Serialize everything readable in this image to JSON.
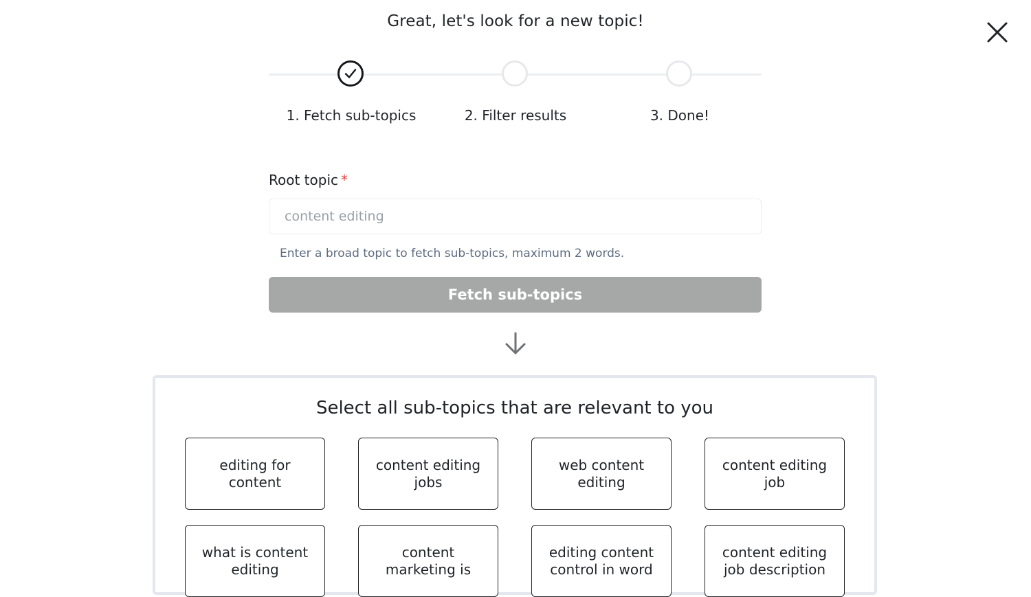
{
  "header": {
    "title": "Great, let's look for a new topic!"
  },
  "steps": [
    {
      "label": "1. Fetch sub-topics",
      "status": "done"
    },
    {
      "label": "2. Filter results",
      "status": "pending"
    },
    {
      "label": "3. Done!",
      "status": "pending"
    }
  ],
  "form": {
    "label": "Root topic",
    "required_mark": "*",
    "input_value": "",
    "input_placeholder": "content editing",
    "helper": "Enter a broad topic to fetch sub-topics, maximum 2 words.",
    "button_label": "Fetch sub-topics"
  },
  "results": {
    "title": "Select all sub-topics that are relevant to you",
    "items": [
      "editing for content",
      "content editing jobs",
      "web content editing",
      "content editing job",
      "what is content editing",
      "content marketing is",
      "editing content control in word",
      "content editing job description"
    ]
  },
  "icons": {
    "close": "close-icon",
    "step_done": "checkmark-icon",
    "arrow": "arrow-down-icon"
  },
  "colors": {
    "disabled_button": "#a6a8a8",
    "required": "#e53935",
    "text": "#1f2328",
    "helper": "#5d6b7f"
  }
}
